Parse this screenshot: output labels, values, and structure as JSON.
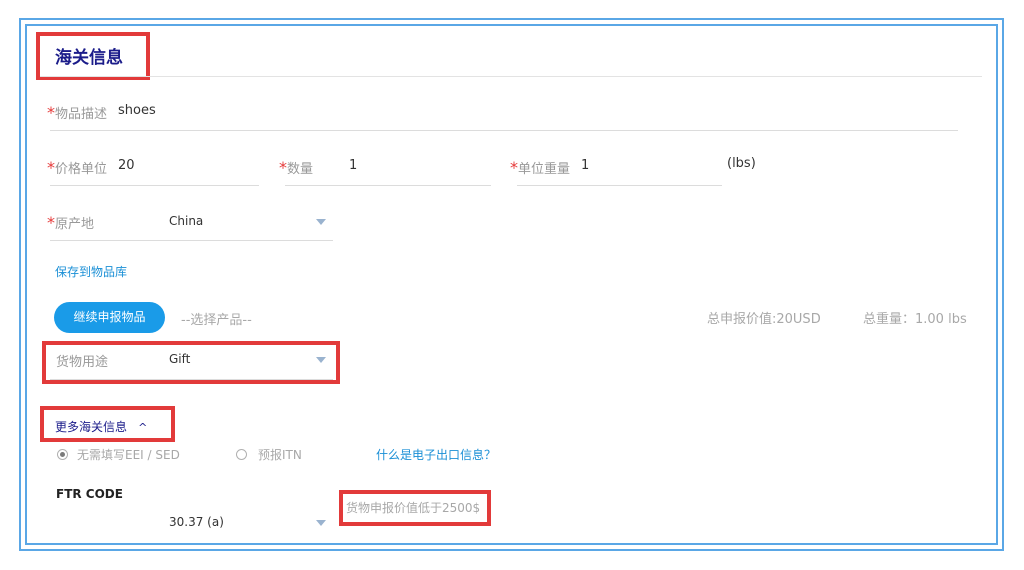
{
  "section": {
    "title": "海关信息"
  },
  "item_desc": {
    "required": "*",
    "label": "物品描述",
    "value": "shoes"
  },
  "price_unit": {
    "required": "*",
    "label": "价格单位",
    "value": "20"
  },
  "quantity": {
    "required": "*",
    "label": "数量",
    "value": "1"
  },
  "unit_weight": {
    "required": "*",
    "label": "单位重量",
    "value": "1",
    "unit": "(lbs)"
  },
  "origin": {
    "required": "*",
    "label": "原产地",
    "value": "China"
  },
  "save_link": "保存到物品库",
  "continue_button": "继续申报物品",
  "select_product": "--选择产品--",
  "totals": {
    "declared_value": "总申报价值:20USD",
    "total_weight": "总重量：1.00 lbs"
  },
  "purpose": {
    "label": "货物用途",
    "value": "Gift"
  },
  "more_info": {
    "label": "更多海关信息",
    "chevron": "^"
  },
  "eei": {
    "option1": "无需填写EEI / SED",
    "option2": "预报ITN",
    "help_link": "什么是电子出口信息？",
    "selected": "option1"
  },
  "ftr": {
    "label": "FTR CODE",
    "value": "30.37 (a)",
    "note": "货物申报价值低于2500$"
  },
  "colors": {
    "accent": "#1a9be8",
    "title": "#1b1c8a",
    "highlight": "#e23a3a",
    "frame": "#5aa7e6"
  },
  "icons": {
    "dropdown": "caret-down-icon",
    "radio": "radio-icon"
  }
}
